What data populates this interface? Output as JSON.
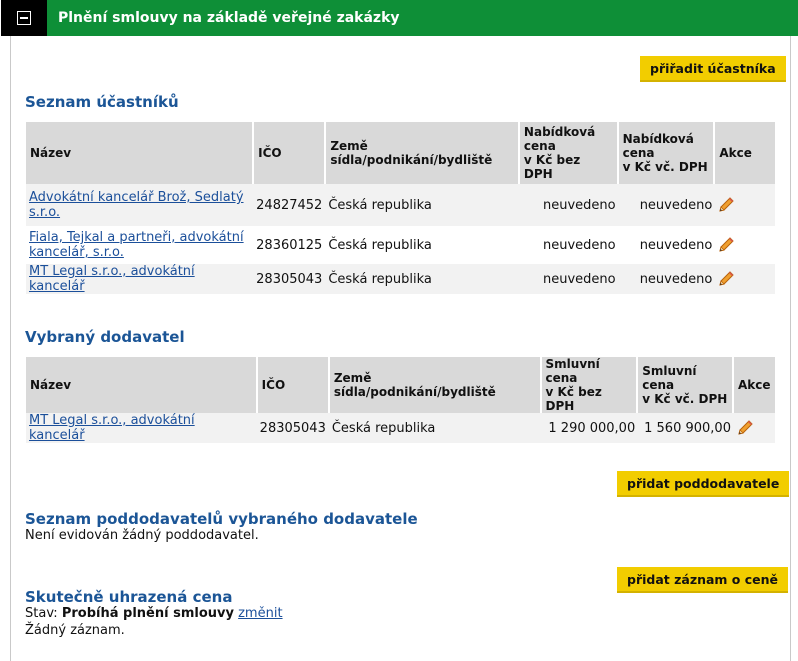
{
  "header": {
    "title": "Plnění smlouvy na základě veřejné zakázky"
  },
  "buttons": {
    "assign_participant": "přiřadit účastníka",
    "add_subcontractor": "přidat poddodavatele",
    "add_price_record": "přidat záznam o ceně"
  },
  "participants": {
    "title": "Seznam účastníků",
    "columns": [
      "Název",
      "IČO",
      "Země sídla/podnikání/bydliště",
      "Nabídková cena v Kč bez DPH",
      "Nabídková cena v Kč vč. DPH",
      "Akce"
    ],
    "rows": [
      {
        "name": "Advokátní kancelář Brož, Sedlatý s.r.o.",
        "ico": "24827452",
        "country": "Česká republika",
        "price_excl": "neuvedeno",
        "price_incl": "neuvedeno"
      },
      {
        "name": "Fiala, Tejkal a partneři, advokátní kancelář, s.r.o.",
        "ico": "28360125",
        "country": "Česká republika",
        "price_excl": "neuvedeno",
        "price_incl": "neuvedeno"
      },
      {
        "name": "MT Legal s.r.o., advokátní kancelář",
        "ico": "28305043",
        "country": "Česká republika",
        "price_excl": "neuvedeno",
        "price_incl": "neuvedeno"
      }
    ]
  },
  "supplier": {
    "title": "Vybraný dodavatel",
    "columns": [
      "Název",
      "IČO",
      "Země sídla/podnikání/bydliště",
      "Smluvní cena v Kč bez DPH",
      "Smluvní cena v Kč vč. DPH",
      "Akce"
    ],
    "rows": [
      {
        "name": "MT Legal s.r.o., advokátní kancelář",
        "ico": "28305043",
        "country": "Česká republika",
        "price_excl": "1 290 000,00",
        "price_incl": "1 560 900,00"
      }
    ]
  },
  "subcontractors": {
    "title": "Seznam poddodavatelů vybraného dodavatele",
    "empty_text": "Není evidován žádný poddodavatel."
  },
  "price": {
    "title": "Skutečně uhrazená cena",
    "status_label": "Stav:",
    "status_value": "Probíhá plnění smlouvy",
    "change_link": "změnit",
    "empty_text": "Žádný záznam."
  },
  "icons": {
    "edit": "pencil-icon"
  },
  "colors": {
    "header_green": "#0e8f37",
    "button_yellow": "#f2cd00",
    "heading_blue": "#1b5596",
    "link_blue": "#1b4f9a"
  }
}
